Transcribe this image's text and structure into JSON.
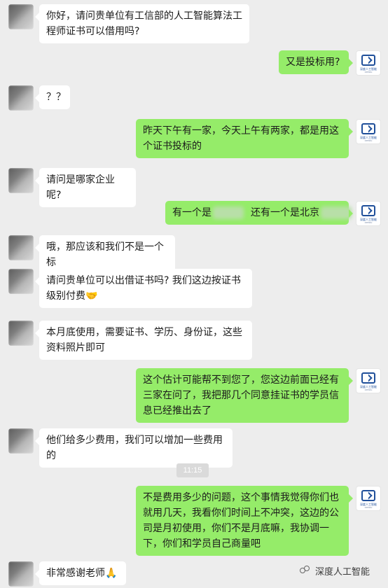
{
  "messages": [
    {
      "side": "in",
      "text": "你好，请问贵单位有工信部的人工智能算法工程师证书可以借用吗?"
    },
    {
      "side": "out",
      "text": "又是投标用?"
    },
    {
      "side": "in",
      "text": "？？"
    },
    {
      "side": "out",
      "text": "昨天下午有一家，今天上午有两家，都是用这个证书投标的"
    },
    {
      "side": "in",
      "text": "请问是哪家企业呢?"
    },
    {
      "side": "out",
      "part1": "有一个是",
      "part2": "还有一个是北京"
    },
    {
      "side": "in",
      "text": "哦，那应该和我们不是一个标"
    },
    {
      "side": "in",
      "text": "请问贵单位可以出借证书吗? 我们这边按证书级别付费"
    },
    {
      "side": "in",
      "text": "本月底使用，需要证书、学历、身份证，这些资料照片即可"
    },
    {
      "side": "out",
      "text": "这个估计可能帮不到您了，您这边前面已经有三家在问了，我把那几个同意挂证书的学员信息已经推出去了"
    },
    {
      "side": "in",
      "text": "他们给多少费用，我们可以增加一些费用的"
    },
    {
      "side": "out",
      "text": "不是费用多少的问题，这个事情我觉得你们也就用几天，我看你们时间上不冲突，这边的公司是月初使用，你们不是月底嘛，我协调一下，你们和学员自己商量吧"
    },
    {
      "side": "in",
      "text": "非常感谢老师"
    }
  ],
  "timestamp": "11:15",
  "emoji": {
    "handshake": "🤝",
    "bow": "🙏"
  },
  "watermark": {
    "text": "深度人工智能"
  },
  "colors": {
    "background": "#ededed",
    "outgoing_bubble": "#95ec69",
    "incoming_bubble": "#ffffff"
  }
}
